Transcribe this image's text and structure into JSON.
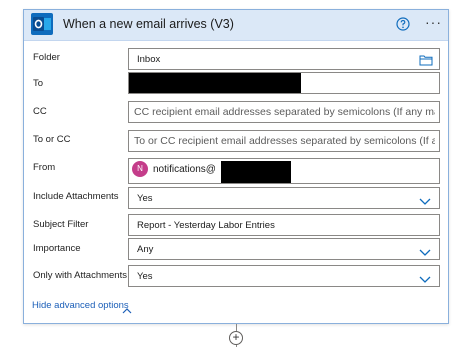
{
  "header": {
    "title": "When a new email arrives (V3)",
    "app_icon": "outlook-icon",
    "help_icon": "help-circle-icon",
    "more_icon": "ellipsis-icon",
    "more_glyph": "···"
  },
  "fields": {
    "folder": {
      "label": "Folder",
      "value": "Inbox",
      "icon": "folder-icon"
    },
    "to": {
      "label": "To",
      "value": ""
    },
    "cc": {
      "label": "CC",
      "placeholder": "CC recipient email addresses separated by semicolons (If any match, t"
    },
    "to_or_cc": {
      "label": "To or CC",
      "placeholder": "To or CC recipient email addresses separated by semicolons (If any m"
    },
    "from": {
      "label": "From",
      "avatar_initial": "N",
      "value": "notifications@"
    },
    "include_attachments": {
      "label": "Include Attachments",
      "value": "Yes"
    },
    "subject_filter": {
      "label": "Subject Filter",
      "value": "Report - Yesterday Labor Entries"
    },
    "importance": {
      "label": "Importance",
      "value": "Any"
    },
    "only_with_attachments": {
      "label": "Only with Attachments",
      "value": "Yes"
    }
  },
  "advanced": {
    "label": "Hide advanced options"
  },
  "add_step": {
    "glyph": "+"
  },
  "colors": {
    "accent": "#0f6cbd",
    "header_bg": "#dbe8f7",
    "link": "#1c5fb8",
    "avatar": "#c43d8a"
  }
}
